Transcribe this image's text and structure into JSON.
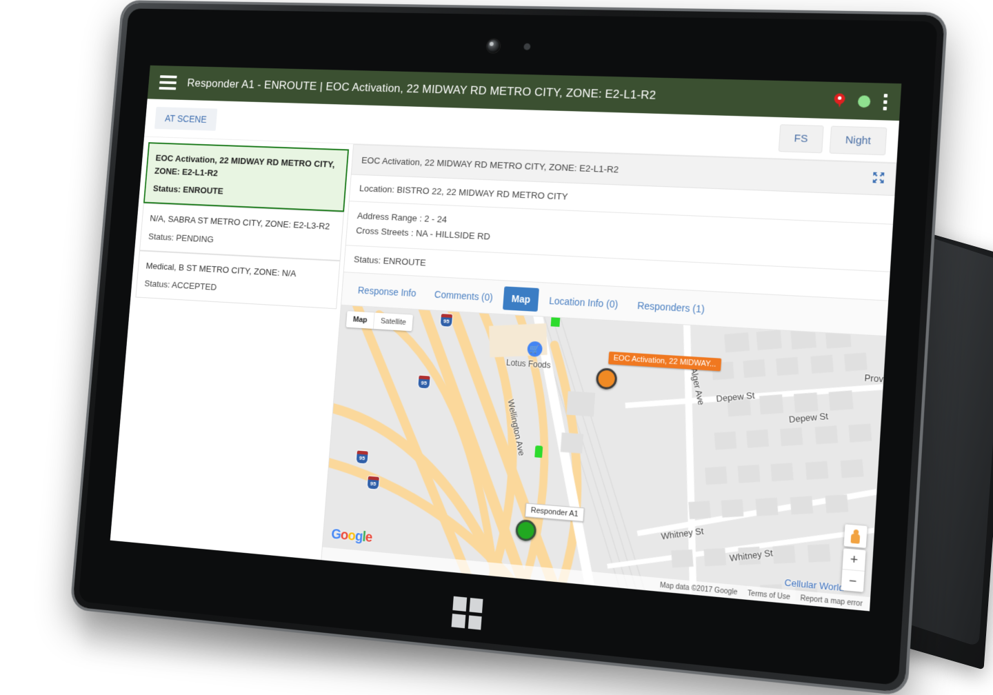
{
  "appbar": {
    "menu_icon": "hamburger-menu-icon",
    "title": "Responder A1 - ENROUTE | EOC Activation, 22 MIDWAY RD METRO CITY, ZONE: E2-L1-R2",
    "status_pin_icon": "location-pin-icon",
    "status_dot_icon": "online-status-dot",
    "overflow_icon": "kebab-menu-icon"
  },
  "subbar": {
    "at_scene_label": "AT SCENE",
    "fs_label": "FS",
    "night_label": "Night"
  },
  "incident_list": [
    {
      "title": "EOC Activation, 22 MIDWAY RD METRO CITY, ZONE: E2-L1-R2",
      "status": "Status: ENROUTE",
      "selected": true
    },
    {
      "title": "N/A, SABRA ST METRO CITY, ZONE: E2-L3-R2",
      "status": "Status: PENDING",
      "selected": false
    },
    {
      "title": "Medical, B ST METRO CITY, ZONE: N/A",
      "status": "Status: ACCEPTED",
      "selected": false
    }
  ],
  "detail": {
    "header": "EOC Activation, 22 MIDWAY RD METRO CITY, ZONE: E2-L1-R2",
    "expand_icon": "expand-fullscreen-icon",
    "location": "Location: BISTRO 22, 22 MIDWAY RD METRO CITY",
    "address_range": "Address Range : 2 - 24",
    "cross_streets": "Cross Streets : NA - HILLSIDE RD",
    "status": "Status: ENROUTE"
  },
  "tabs": [
    {
      "label": "Response Info",
      "active": false
    },
    {
      "label": "Comments (0)",
      "active": false
    },
    {
      "label": "Map",
      "active": true
    },
    {
      "label": "Location Info (0)",
      "active": false
    },
    {
      "label": "Responders (1)",
      "active": false
    }
  ],
  "map": {
    "type_map_label": "Map",
    "type_satellite_label": "Satellite",
    "incident_marker_label": "EOC Activation, 22 MIDWAY...",
    "responder_marker_label": "Responder A1",
    "poi_labels": [
      "Lotus Foods",
      "Cellular World"
    ],
    "street_labels": [
      "Wellington Ave",
      "Alger Ave",
      "Depew St",
      "Depew St",
      "Whitney St",
      "Whitney St",
      "Prov"
    ],
    "highway_shield": "95",
    "google_logo": "Google",
    "attribution": "Map data ©2017 Google",
    "terms_label": "Terms of Use",
    "report_label": "Report a map error",
    "zoom_in_label": "+",
    "zoom_out_label": "−",
    "pegman_icon": "street-view-pegman-icon"
  },
  "device": {
    "home_button_icon": "windows-logo-button",
    "camera_icon": "front-camera-lens",
    "sensor_icon": "ambient-light-sensor"
  },
  "colors": {
    "appbar_green": "#3b5031",
    "selected_card_border": "#1b7a1b",
    "selected_card_bg": "#e8f5e2",
    "active_tab_blue": "#3b7dc4",
    "link_blue": "#4a7fc1",
    "incident_marker_orange": "#f08a24",
    "responder_marker_green": "#21a821"
  }
}
